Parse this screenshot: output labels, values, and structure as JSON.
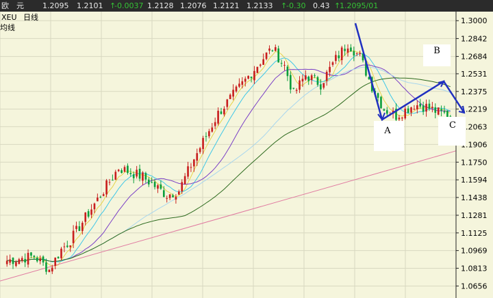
{
  "quote_bar": {
    "name": "欧　元",
    "last": "1.2095",
    "bid": "1.2101",
    "arrow_change": "↑",
    "change": "-0.0037",
    "open": "1.2128",
    "low": "1.2076",
    "high": "1.2121",
    "prev": "1.2133",
    "arrow_pct": "↑",
    "pct": "-0.30",
    "amp": "0.43",
    "arrow_time": "↑",
    "time": "1.2095/01"
  },
  "chart_header": {
    "symbol": "XEU",
    "period": "日线",
    "ma_label": "均线"
  },
  "colors": {
    "background": "#f5f5dc",
    "grid": "#d8d8c0",
    "up_candle": "#c81e1e",
    "down_candle": "#0a9e3c",
    "ma_short": "#e6d44a",
    "ma_mid_cyan": "#3ec7e8",
    "ma_purple": "#7a3fc6",
    "ma_lightblue": "#a8d6ee",
    "ma_long": "#2d6a1e",
    "ma_pink": "#e07aa0",
    "annotation": "#2030c0"
  },
  "chart_data": {
    "type": "candlestick",
    "y_axis_position": "right",
    "y_ticks": [
      "1.3000",
      "1.2842",
      "1.2684",
      "1.2531",
      "1.2375",
      "1.2219",
      "1.2063",
      "1.1906",
      "1.1750",
      "1.1594",
      "1.1438",
      "1.1281",
      "1.1125",
      "1.0969",
      "1.0813",
      "1.0656"
    ],
    "y_tick_values": [
      1.3,
      1.2842,
      1.2684,
      1.2531,
      1.2375,
      1.2219,
      1.2063,
      1.1906,
      1.175,
      1.1594,
      1.1438,
      1.1281,
      1.1125,
      1.0969,
      1.0813,
      1.0656
    ],
    "ylim": [
      1.055,
      1.308
    ],
    "waypoints": [
      [
        0,
        1.088
      ],
      [
        9,
        1.092
      ],
      [
        14,
        1.08
      ],
      [
        18,
        1.098
      ],
      [
        21,
        1.106
      ],
      [
        29,
        1.138
      ],
      [
        37,
        1.17
      ],
      [
        45,
        1.162
      ],
      [
        53,
        1.146
      ],
      [
        57,
        1.15
      ],
      [
        62,
        1.178
      ],
      [
        70,
        1.218
      ],
      [
        78,
        1.244
      ],
      [
        84,
        1.264
      ],
      [
        88,
        1.276
      ],
      [
        92,
        1.26
      ],
      [
        95,
        1.235
      ],
      [
        99,
        1.252
      ],
      [
        104,
        1.244
      ],
      [
        109,
        1.266
      ],
      [
        113,
        1.28
      ],
      [
        117,
        1.268
      ],
      [
        121,
        1.242
      ],
      [
        125,
        1.222
      ],
      [
        129,
        1.216
      ],
      [
        135,
        1.226
      ],
      [
        139,
        1.224
      ],
      [
        143,
        1.219
      ],
      [
        147,
        1.216
      ]
    ],
    "annotations": {
      "labels": [
        "A",
        "B",
        "C"
      ]
    }
  }
}
